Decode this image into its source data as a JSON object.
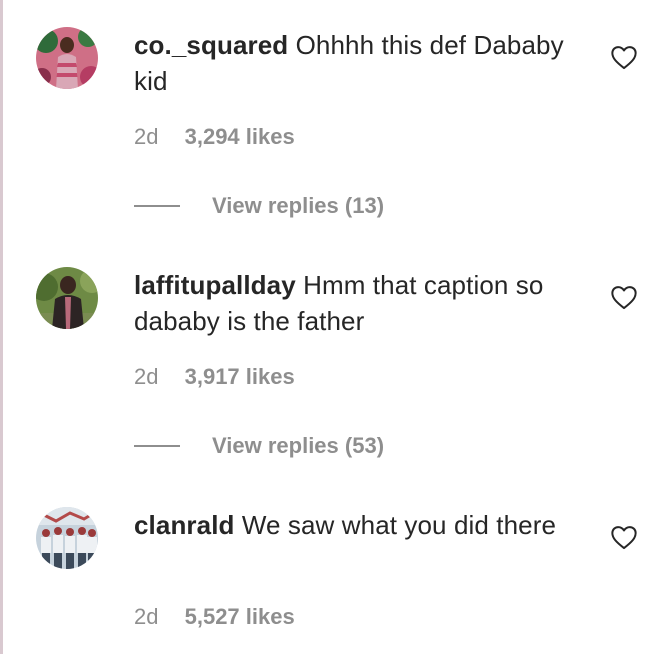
{
  "comments": [
    {
      "avatar_icon": "user-avatar-photo",
      "username": "co._squared",
      "text": "Ohhhh this def Dababy kid",
      "time": "2d",
      "likes": "3,294 likes",
      "replies": "View replies (13)",
      "colors": {
        "bg": "#c4506d",
        "accent": "#2e6b3a",
        "skin": "#5a3a2a"
      }
    },
    {
      "avatar_icon": "user-avatar-photo",
      "username": "laffitupallday",
      "text": "Hmm that caption so dababy is the father",
      "time": "2d",
      "likes": "3,917 likes",
      "replies": "View replies (53)",
      "colors": {
        "bg": "#5c7a3a",
        "accent": "#9a7b5a",
        "skin": "#3d2a22"
      }
    },
    {
      "avatar_icon": "user-avatar-photo",
      "username": "clanrald",
      "text": "We saw what you did there",
      "time": "2d",
      "likes": "5,527 likes",
      "colors": {
        "bg": "#b9c7d4",
        "accent": "#a33a3a",
        "skin": "#6a7a8a"
      }
    }
  ],
  "heart_icon": "heart-outline-icon",
  "theme": {
    "text": "#262626",
    "muted": "#8e8e8e"
  }
}
